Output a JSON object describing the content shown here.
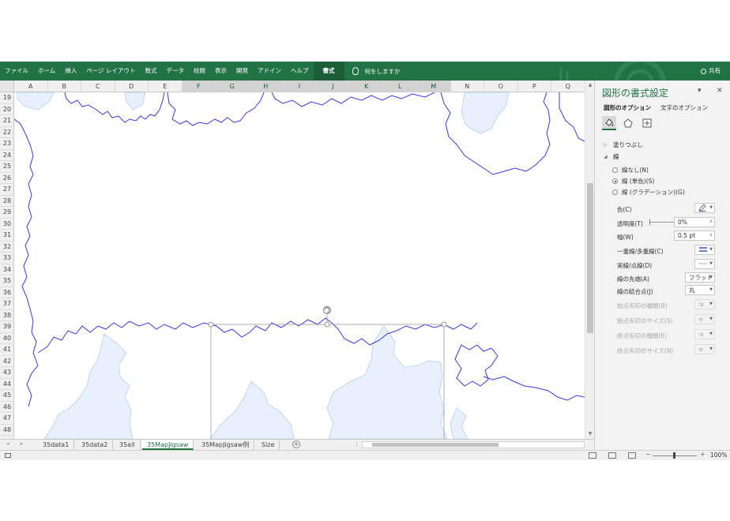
{
  "ribbon": {
    "tabs": [
      "ファイル",
      "ホーム",
      "挿入",
      "ページ レイアウト",
      "数式",
      "データ",
      "校閲",
      "表示",
      "開発",
      "アドイン",
      "ヘルプ"
    ],
    "active_tab": "書式",
    "tell_me": "何をしますか",
    "share": "共有",
    "color": "#217346"
  },
  "grid": {
    "columns": [
      "A",
      "B",
      "C",
      "D",
      "E",
      "F",
      "G",
      "H",
      "I",
      "J",
      "K",
      "L",
      "M",
      "N",
      "O",
      "P",
      "Q"
    ],
    "selected_columns": [
      "F",
      "G",
      "H",
      "I",
      "J",
      "K",
      "L",
      "M"
    ],
    "rows": [
      "19",
      "20",
      "21",
      "22",
      "23",
      "24",
      "25",
      "26",
      "27",
      "28",
      "29",
      "30",
      "31",
      "32",
      "33",
      "34",
      "35",
      "36",
      "37",
      "38",
      "39",
      "40",
      "41",
      "42",
      "43",
      "44",
      "45",
      "46",
      "47",
      "48"
    ]
  },
  "sheets": {
    "tabs": [
      "35data1",
      "35data2",
      "35all",
      "35MapJigsaw",
      "35MapJigsaw例",
      "Size"
    ],
    "active": "35MapJigsaw",
    "nav": "◂ ▸",
    "add": "+"
  },
  "status": {
    "zoom_minus": "−",
    "zoom_plus": "+",
    "zoom": "100%"
  },
  "pane": {
    "title": "図形の書式設定",
    "tabs": [
      "図形のオプション",
      "文字のオプション"
    ],
    "icons": [
      "fill-line-icon",
      "effects-icon",
      "size-properties-icon"
    ],
    "section_fill": "塗りつぶし",
    "section_line": "線",
    "line_options": [
      "線なし(N)",
      "線 (単色)(S)",
      "線 (グラデーション)(G)"
    ],
    "selected_line_option": 1,
    "props": {
      "color": "色(C)",
      "transparency": "透明度(T)",
      "transparency_value": "0%",
      "width": "幅(W)",
      "width_value": "0.5 pt",
      "compound": "一重線/多重線(C)",
      "dash": "実線/点線(D)",
      "cap": "線の先端(A)",
      "cap_value": "フラット",
      "join": "線の結合点(J)",
      "join_value": "丸",
      "begin_arrow_type": "始点矢印の種類(B)",
      "begin_arrow_size": "始点矢印のサイズ(S)",
      "end_arrow_type": "終点矢印の種類(E)",
      "end_arrow_size": "終点矢印のサイズ(N)"
    }
  }
}
